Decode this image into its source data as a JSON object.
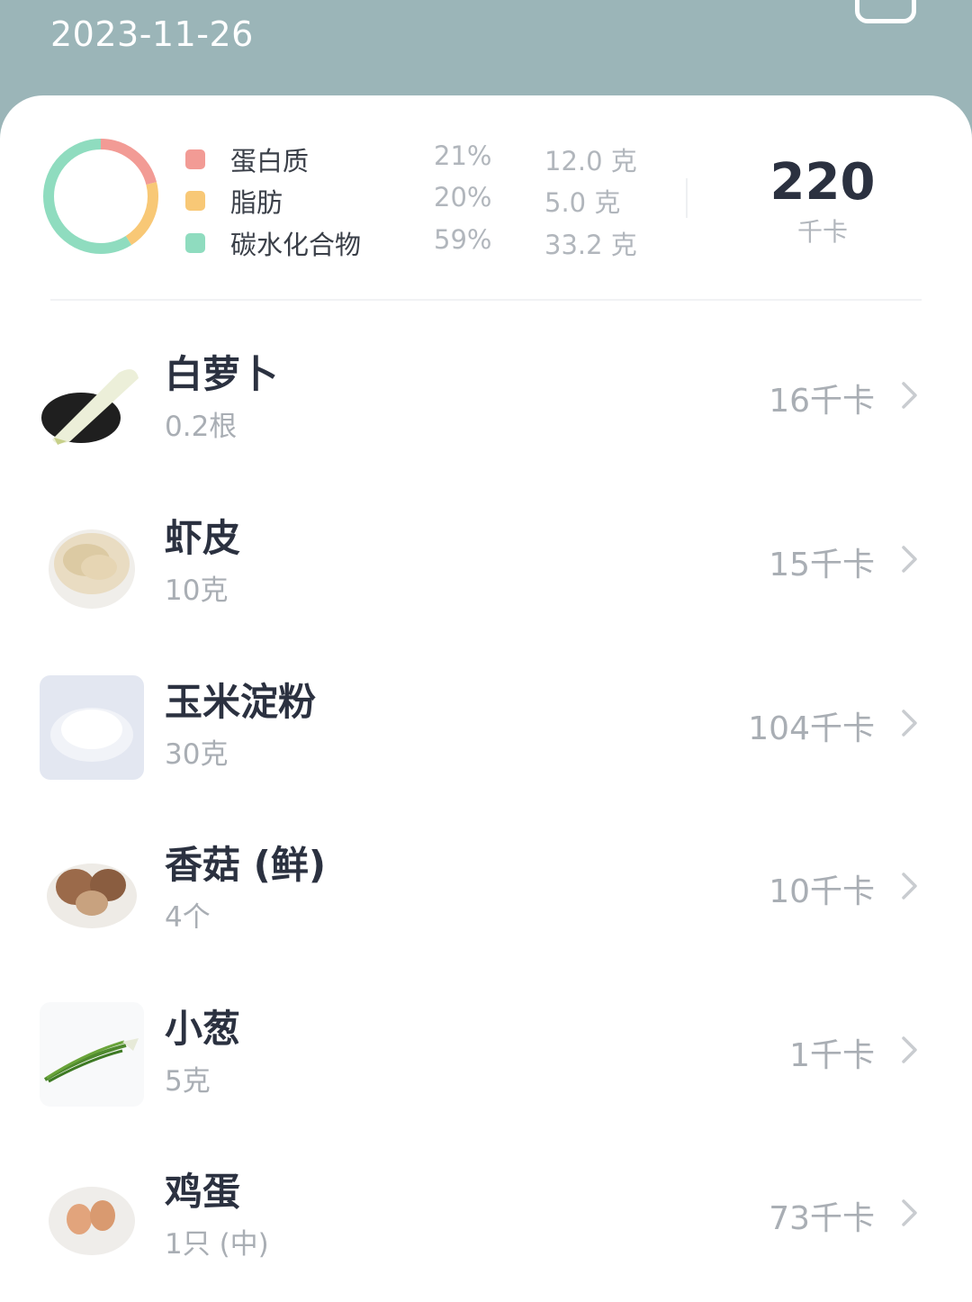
{
  "header": {
    "date": "2023-11-26"
  },
  "summary": {
    "macros": [
      {
        "name": "蛋白质",
        "percent": "21%",
        "grams": "12.0 克",
        "color": "#f29b95",
        "share": 0.21
      },
      {
        "name": "脂肪",
        "percent": "20%",
        "grams": "5.0 克",
        "color": "#f8c876",
        "share": 0.2
      },
      {
        "name": "碳水化合物",
        "percent": "59%",
        "grams": "33.2 克",
        "color": "#8fdcbf",
        "share": 0.59
      }
    ],
    "total_kcal": "220",
    "total_unit": "千卡"
  },
  "foods": [
    {
      "name": "白萝卜",
      "qty": "0.2根",
      "kcal": "16千卡",
      "icon": "white-radish-icon"
    },
    {
      "name": "虾皮",
      "qty": "10克",
      "kcal": "15千卡",
      "icon": "dried-shrimp-icon"
    },
    {
      "name": "玉米淀粉",
      "qty": "30克",
      "kcal": "104千卡",
      "icon": "cornstarch-icon"
    },
    {
      "name": "香菇 (鲜)",
      "qty": "4个",
      "kcal": "10千卡",
      "icon": "shiitake-icon"
    },
    {
      "name": "小葱",
      "qty": "5克",
      "kcal": "1千卡",
      "icon": "scallion-icon"
    },
    {
      "name": "鸡蛋",
      "qty": "1只 (中)",
      "kcal": "73千卡",
      "icon": "egg-icon"
    }
  ]
}
